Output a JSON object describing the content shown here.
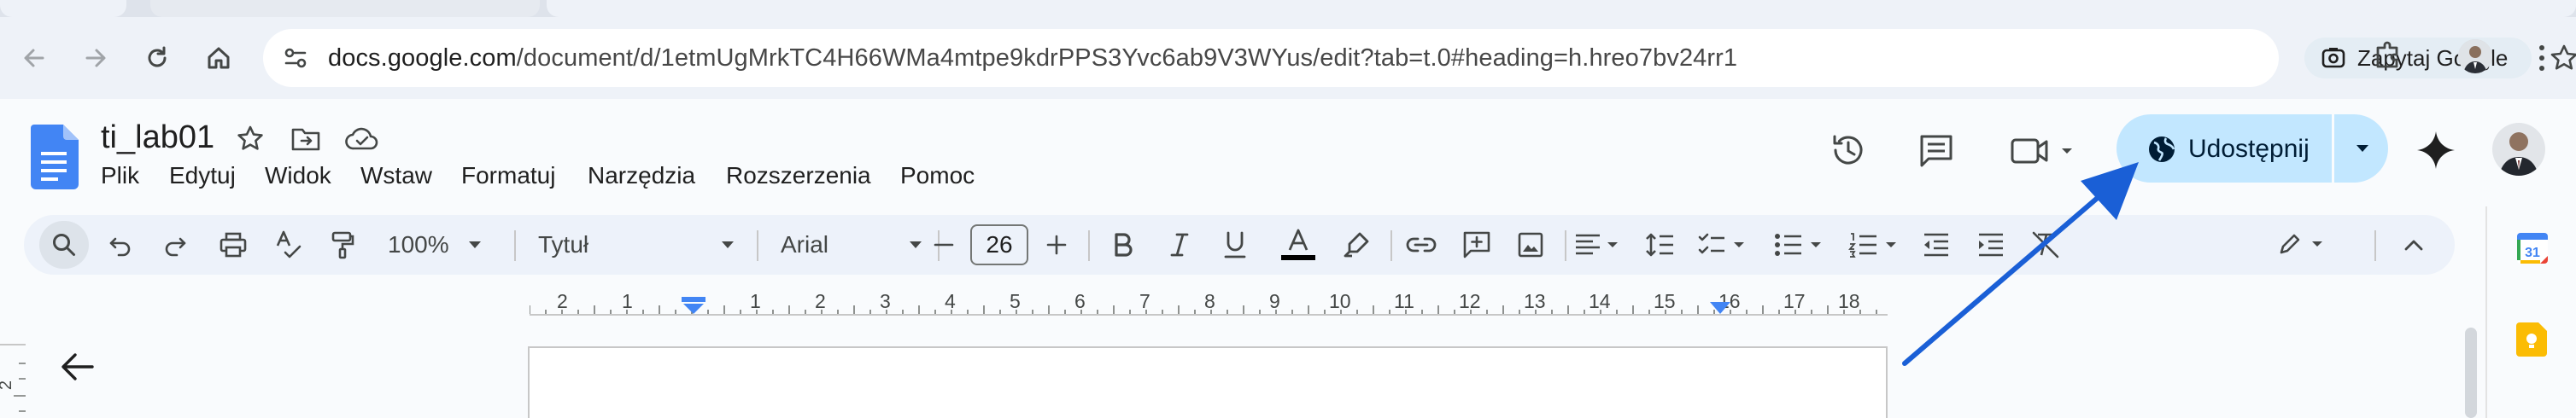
{
  "browser": {
    "url_host": "docs.google.com",
    "url_path": "/document/d/1etmUgMrkTC4H66WMa4mtpe9kdrPPS3Yvc6ab9V3WYus/edit?tab=t.0#heading=h.hreo7bv24rr1",
    "ask_google_label": "Zapytaj Google"
  },
  "doc": {
    "title": "ti_lab01"
  },
  "menu": {
    "items": [
      "Plik",
      "Edytuj",
      "Widok",
      "Wstaw",
      "Formatuj",
      "Narzędzia",
      "Rozszerzenia",
      "Pomoc"
    ]
  },
  "header": {
    "share_label": "Udostępnij"
  },
  "toolbar": {
    "zoom": "100%",
    "style": "Tytuł",
    "font": "Arial",
    "font_size": "26"
  },
  "ruler": {
    "ticks": [
      "2",
      "1",
      "1",
      "2",
      "3",
      "4",
      "5",
      "6",
      "7",
      "8",
      "9",
      "10",
      "11",
      "12",
      "13",
      "14",
      "15",
      "16",
      "17",
      "18"
    ]
  },
  "left_ruler": {
    "tick": "2"
  },
  "colors": {
    "share_bg": "#c2e7ff",
    "toolbar_bg": "#edf2fa",
    "annotation_arrow": "#1a5fd6",
    "docs_blue": "#4285f4"
  },
  "icons": [
    "back-arrow-icon",
    "forward-arrow-icon",
    "reload-icon",
    "home-icon",
    "site-info-icon",
    "lens-icon",
    "bookmark-star-icon",
    "extensions-icon",
    "docs-logo-icon",
    "star-icon",
    "move-folder-icon",
    "cloud-saved-icon",
    "history-icon",
    "comments-icon",
    "meet-icon",
    "globe-icon",
    "gemini-icon",
    "search-menus-icon",
    "undo-icon",
    "redo-icon",
    "print-icon",
    "spellcheck-icon",
    "paint-format-icon",
    "minus-icon",
    "plus-icon",
    "bold-icon",
    "italic-icon",
    "underline-icon",
    "text-color-icon",
    "highlight-icon",
    "link-icon",
    "add-comment-icon",
    "insert-image-icon",
    "align-icon",
    "line-spacing-icon",
    "checklist-icon",
    "bulleted-list-icon",
    "numbered-list-icon",
    "decrease-indent-icon",
    "increase-indent-icon",
    "clear-formatting-icon",
    "editing-mode-icon",
    "collapse-icon",
    "calendar-icon",
    "keep-icon",
    "outline-back-icon"
  ]
}
